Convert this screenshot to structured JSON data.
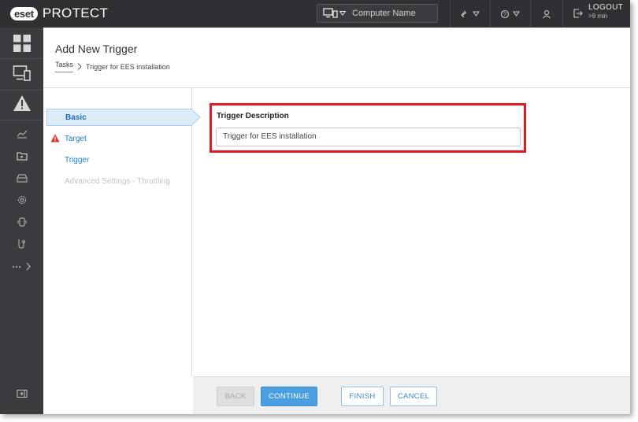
{
  "app": {
    "logo_badge": "eset",
    "product_name": "PROTECT"
  },
  "topbar": {
    "search_placeholder": "Computer Name",
    "logout_label": "LOGOUT",
    "logout_time": ">9 min"
  },
  "page": {
    "title": "Add New Trigger",
    "breadcrumb": {
      "parent": "Tasks",
      "current": "Trigger for EES installation"
    }
  },
  "wizard": {
    "steps": [
      {
        "label": "Basic",
        "state": "active"
      },
      {
        "label": "Target",
        "state": "warning"
      },
      {
        "label": "Trigger",
        "state": "link"
      },
      {
        "label": "Advanced Settings - Throttling",
        "state": "disabled"
      }
    ]
  },
  "form": {
    "description_label": "Trigger Description",
    "description_value": "Trigger for EES installation"
  },
  "footer": {
    "back_label": "BACK",
    "continue_label": "CONTINUE",
    "finish_label": "FINISH",
    "cancel_label": "CANCEL"
  },
  "colors": {
    "topbar_bg": "#2f3033",
    "sidebar_bg": "#3a3b3f",
    "accent_blue": "#4a9fe0",
    "highlight_red": "#e01a22",
    "warning_red": "#d9312b"
  }
}
